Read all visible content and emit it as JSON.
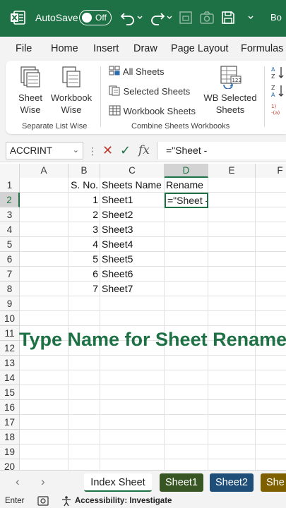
{
  "titlebar": {
    "autosave_label": "AutoSave",
    "autosave_state": "Off",
    "book_name": "Bo"
  },
  "ribbon_tabs": [
    "File",
    "Home",
    "Insert",
    "Draw",
    "Page Layout",
    "Formulas"
  ],
  "ribbon": {
    "sheet_wise": "Sheet\nWise",
    "workbook_wise": "Workbook\nWise",
    "group1_label": "Separate List Wise",
    "all_sheets": "All Sheets",
    "selected_sheets": "Selected Sheets",
    "workbook_sheets": "Workbook Sheets",
    "wb_selected": "WB Selected\nSheets",
    "group2_label": "Combine Sheets Workbooks"
  },
  "formula_bar": {
    "name_box": "ACCRINT",
    "formula": "=\"Sheet -"
  },
  "columns": [
    "A",
    "B",
    "C",
    "D",
    "E",
    "F"
  ],
  "rows": [
    "1",
    "2",
    "3",
    "4",
    "5",
    "6",
    "7",
    "8",
    "9",
    "10",
    "11",
    "12",
    "13",
    "14",
    "15",
    "16",
    "17",
    "18",
    "19",
    "20"
  ],
  "table": {
    "headers": {
      "b": "S. No.",
      "c": "Sheets Name",
      "d": "Rename"
    },
    "records": [
      {
        "no": "1",
        "name": "Sheet1"
      },
      {
        "no": "2",
        "name": "Sheet2"
      },
      {
        "no": "3",
        "name": "Sheet3"
      },
      {
        "no": "4",
        "name": "Sheet4"
      },
      {
        "no": "5",
        "name": "Sheet5"
      },
      {
        "no": "6",
        "name": "Sheet6"
      },
      {
        "no": "7",
        "name": "Sheet7"
      }
    ],
    "active_cell_value": "=\"Sheet -"
  },
  "caption": "Type Name for Sheet Rename!",
  "sheet_tabs": [
    {
      "label": "Index Sheet",
      "color": "#ffffff",
      "text": "#1e1e1e"
    },
    {
      "label": "Sheet1",
      "color": "#375623",
      "text": "#ffffff"
    },
    {
      "label": "Sheet2",
      "color": "#1f4e79",
      "text": "#ffffff"
    },
    {
      "label": "She",
      "color": "#7f6000",
      "text": "#ffffff"
    }
  ],
  "status": {
    "mode": "Enter",
    "accessibility": "Accessibility: Investigate"
  },
  "colors": {
    "brand": "#1e7145"
  }
}
